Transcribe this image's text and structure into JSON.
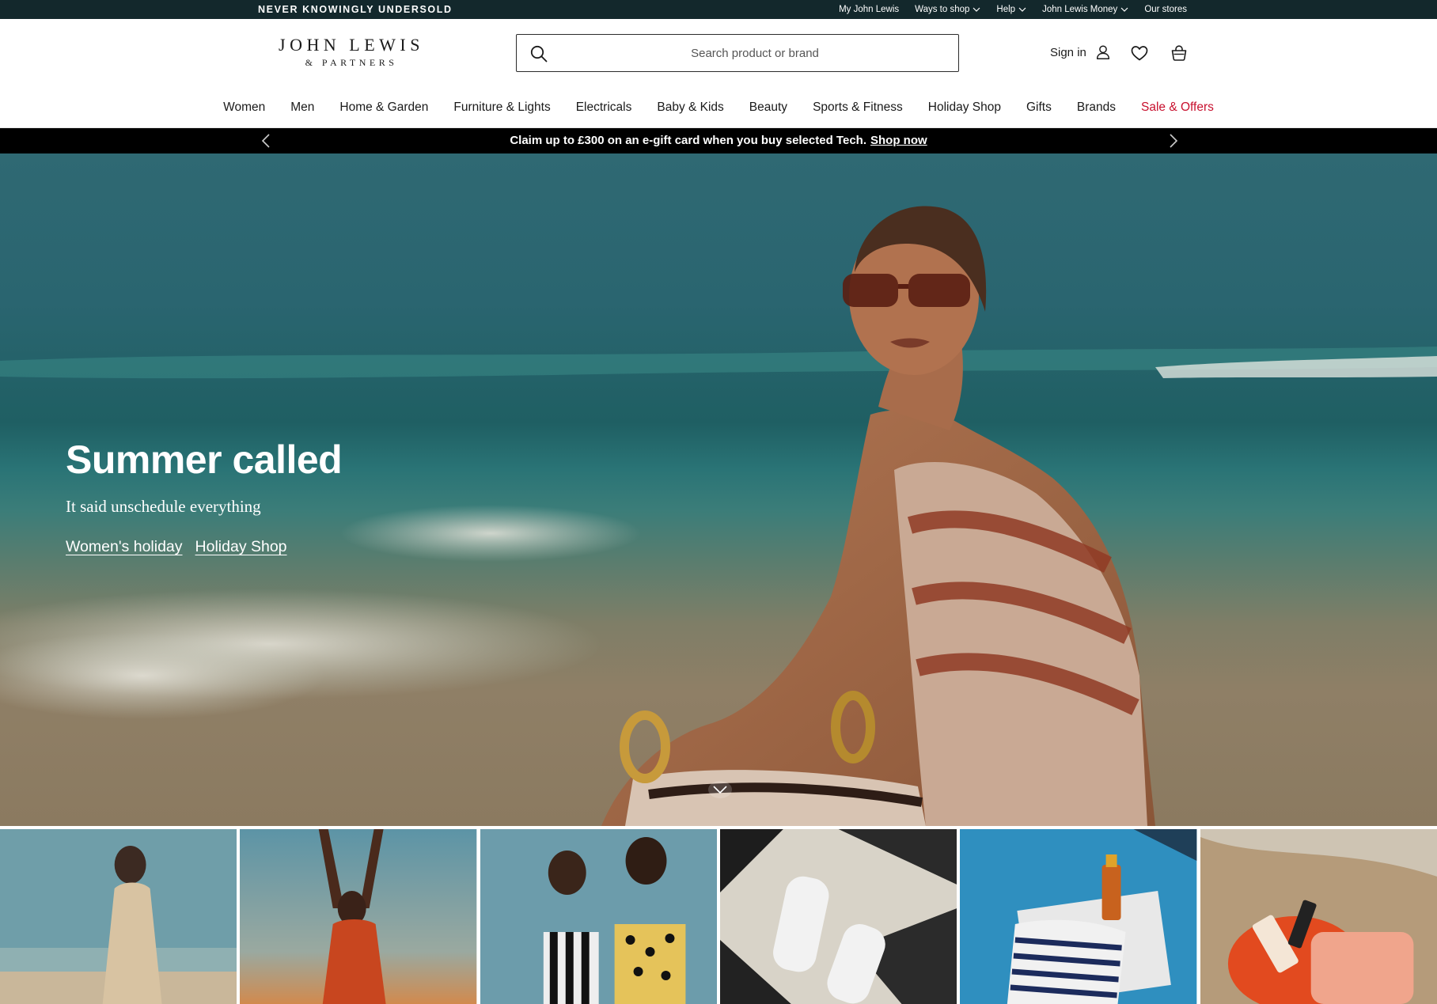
{
  "utility": {
    "tagline": "NEVER KNOWINGLY UNDERSOLD",
    "links": [
      {
        "label": "My John Lewis"
      },
      {
        "label": "Ways to shop"
      },
      {
        "label": "Help"
      },
      {
        "label": "John Lewis Money"
      },
      {
        "label": "Our stores"
      }
    ]
  },
  "logo": {
    "main": "JOHN LEWIS",
    "sub": "& PARTNERS"
  },
  "search": {
    "placeholder": "Search product or brand",
    "icon": "search-icon"
  },
  "account": {
    "sign_in": "Sign in",
    "user_icon": "user-icon",
    "wishlist_icon": "heart-icon",
    "basket_icon": "basket-icon"
  },
  "nav": [
    {
      "label": "Women"
    },
    {
      "label": "Men"
    },
    {
      "label": "Home & Garden"
    },
    {
      "label": "Furniture & Lights"
    },
    {
      "label": "Electricals"
    },
    {
      "label": "Baby & Kids"
    },
    {
      "label": "Beauty"
    },
    {
      "label": "Sports & Fitness"
    },
    {
      "label": "Holiday Shop"
    },
    {
      "label": "Gifts"
    },
    {
      "label": "Brands"
    },
    {
      "label": "Sale & Offers"
    }
  ],
  "promo": {
    "text": "Claim up to £300 on an e-gift card when you buy selected Tech.",
    "link": "Shop now"
  },
  "hero": {
    "title": "Summer called",
    "subtitle": "It said unschedule everything",
    "links": [
      {
        "label": "Women's holiday"
      },
      {
        "label": "Holiday Shop"
      }
    ]
  },
  "colors": {
    "utility_bg": "#13282c",
    "promo_bg": "#000000",
    "sale": "#c8102e",
    "hero_sea": "#2a6570",
    "hero_sand": "#8b7a60"
  }
}
